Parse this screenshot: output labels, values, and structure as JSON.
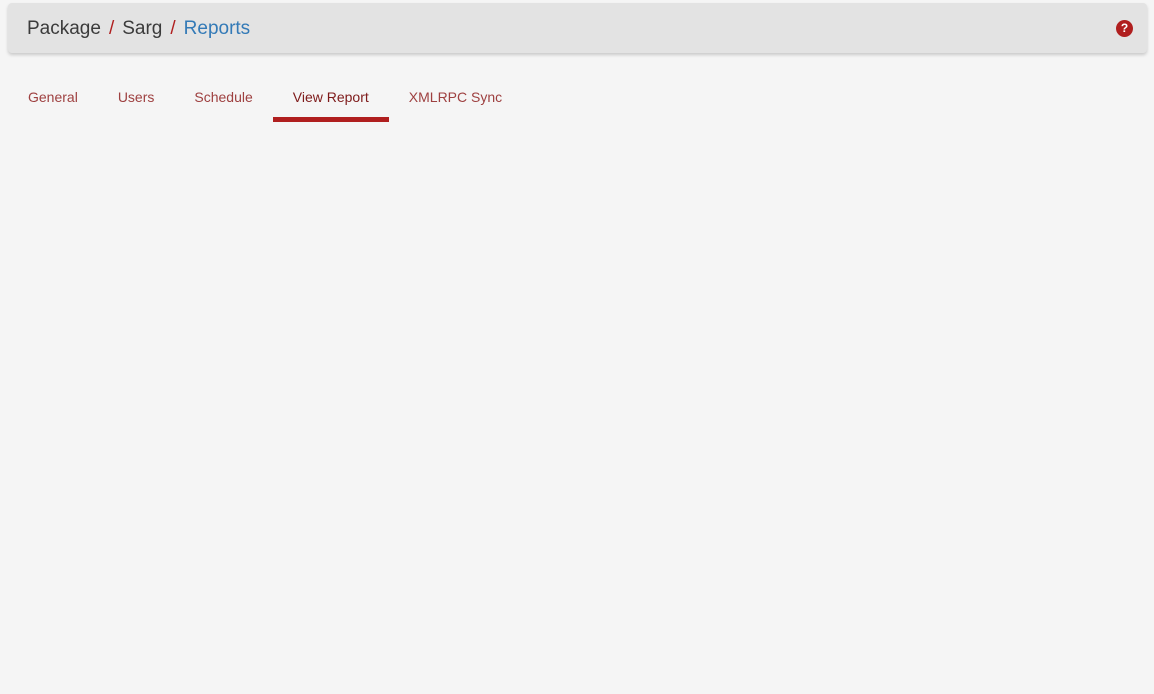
{
  "colors": {
    "page_bg": "#f5f5f5",
    "header_bg": "#e3e3e3",
    "breadcrumb_text": "#3b3b3b",
    "accent_red": "#b01f1f",
    "link_blue": "#337ab7",
    "tab_inactive": "#9e4040",
    "tab_active_text": "#7e1a1a"
  },
  "header": {
    "breadcrumb": {
      "separator": "/",
      "items": [
        {
          "label": "Package",
          "link": false
        },
        {
          "label": "Sarg",
          "link": false
        },
        {
          "label": "Reports",
          "link": true
        }
      ]
    },
    "help_icon": {
      "name": "question-circle-icon",
      "glyph": "?"
    }
  },
  "tab_bar": {
    "tabs": [
      {
        "label": "General",
        "active": false
      },
      {
        "label": "Users",
        "active": false
      },
      {
        "label": "Schedule",
        "active": false
      },
      {
        "label": "View Report",
        "active": true
      },
      {
        "label": "XMLRPC Sync",
        "active": false
      }
    ]
  }
}
